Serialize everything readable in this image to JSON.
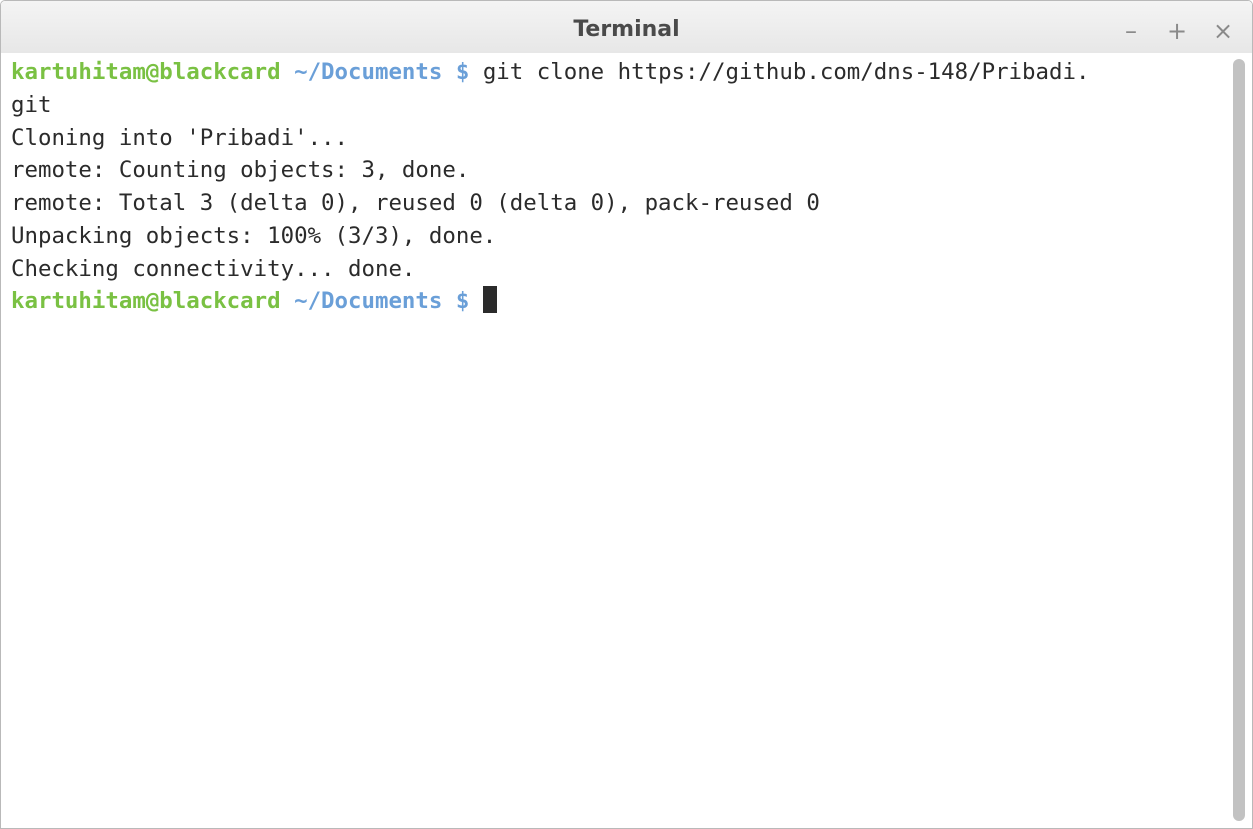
{
  "window": {
    "title": "Terminal",
    "buttons": {
      "minimize": "–",
      "maximize": "+",
      "close": "×"
    }
  },
  "terminal": {
    "colors": {
      "user": "#7ac143",
      "path": "#6a9fd8",
      "text": "#2b2b2b"
    },
    "prompt1": {
      "user": "kartuhitam@blackcard",
      "path": " ~/Documents $ ",
      "command": "git clone https://github.com/dns-148/Pribadi."
    },
    "wrap": "git",
    "output": [
      "Cloning into 'Pribadi'...",
      "remote: Counting objects: 3, done.",
      "remote: Total 3 (delta 0), reused 0 (delta 0), pack-reused 0",
      "Unpacking objects: 100% (3/3), done.",
      "Checking connectivity... done."
    ],
    "prompt2": {
      "user": "kartuhitam@blackcard",
      "path": " ~/Documents $ "
    }
  }
}
